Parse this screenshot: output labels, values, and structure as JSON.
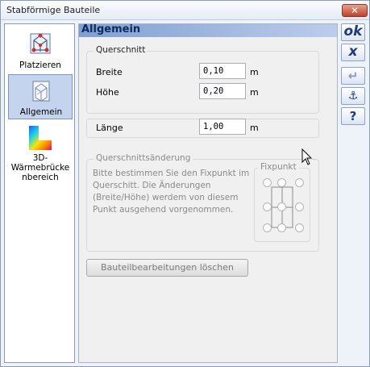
{
  "window": {
    "title": "Stabförmige Bauteile",
    "close_label": "✕"
  },
  "sidebar": {
    "items": [
      {
        "label": "Platzieren"
      },
      {
        "label": "Allgemein"
      },
      {
        "label_lines": [
          "3D-",
          "Wärmebrücke",
          "nbereich"
        ]
      }
    ]
  },
  "header": {
    "title": "Allgemein"
  },
  "querschnitt": {
    "title": "Querschnitt",
    "breite": {
      "label": "Breite",
      "value": "0,10",
      "unit": "m"
    },
    "hoehe": {
      "label": "Höhe",
      "value": "0,20",
      "unit": "m"
    }
  },
  "laenge": {
    "label": "Länge",
    "value": "1,00",
    "unit": "m"
  },
  "querschnittsaenderung": {
    "title": "Querschnittsänderung",
    "description": "Bitte bestimmen Sie den Fixpunkt im Querschitt. Die Änderungen (Breite/Höhe) werdem von diesem Punkt ausgehend vorgenommen.",
    "fixpunkt_title": "Fixpunkt"
  },
  "actions": {
    "reset_label": "Bauteilbearbeitungen löschen"
  },
  "toolbar": {
    "ok_label": "ok",
    "cancel_label": "x",
    "enter_label": "↵",
    "anchor_label": "⚓",
    "help_label": "?"
  }
}
